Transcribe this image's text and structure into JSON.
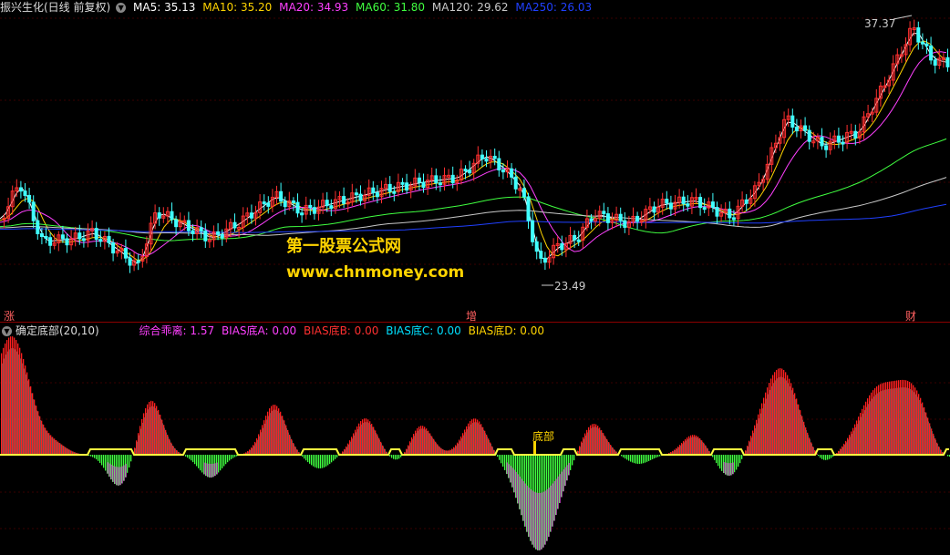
{
  "title": "振兴生化(日线 前复权)",
  "ma": [
    {
      "label": "MA5: 35.13",
      "color": "#ffffff"
    },
    {
      "label": "MA10: 35.20",
      "color": "#ffd400"
    },
    {
      "label": "MA20: 34.93",
      "color": "#ff40ff"
    },
    {
      "label": "MA60: 31.80",
      "color": "#40ff40"
    },
    {
      "label": "MA120: 29.62",
      "color": "#c8c8c8"
    },
    {
      "label": "MA250: 26.03",
      "color": "#2040ff"
    }
  ],
  "indicator": {
    "name": "确定底部(20,10)",
    "values": [
      {
        "label": "综合乖离: 1.57",
        "color": "#ff40ff"
      },
      {
        "label": "BIAS底A: 0.00",
        "color": "#ff40ff"
      },
      {
        "label": "BIAS底B: 0.00",
        "color": "#ff3030"
      },
      {
        "label": "BIAS底C: 0.00",
        "color": "#00e0ff"
      },
      {
        "label": "BIAS底D: 0.00",
        "color": "#ffd400"
      }
    ],
    "bottom_label": "底部"
  },
  "price_high": "37.37",
  "price_low": "23.49",
  "flags": {
    "zhang": "涨",
    "zeng": "增",
    "cai": "财"
  },
  "watermark": {
    "line1": "第一股票公式网",
    "line2": "www.chnmoney.com"
  },
  "colors": {
    "up": "#ff3030",
    "down": "#40ffff",
    "bg": "#000000"
  }
}
